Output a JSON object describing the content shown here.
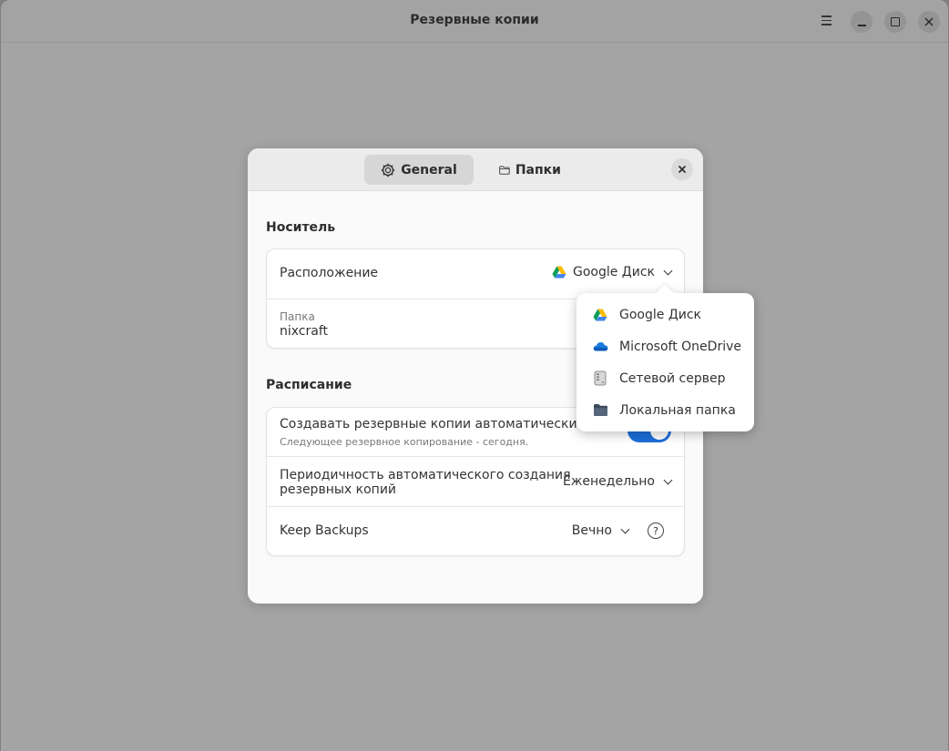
{
  "window": {
    "title": "Резервные копии"
  },
  "dialog": {
    "tabs": [
      {
        "label": "General",
        "icon": "gear-icon",
        "selected": true
      },
      {
        "label": "Папки",
        "icon": "folder-icon",
        "selected": false
      }
    ],
    "storage": {
      "section_title": "Носитель",
      "location_label": "Расположение",
      "location_value": "Google Диск",
      "folder_label": "Папка",
      "folder_value": "nixcraft"
    },
    "schedule": {
      "section_title": "Расписание",
      "auto_backup_label": "Создавать резервные копии автоматически",
      "auto_backup_sub": "Следующее резервное копирование - сегодня.",
      "auto_backup_enabled": true,
      "frequency_label_line1": "Периодичность автоматического создания",
      "frequency_label_line2": "резервных копий",
      "frequency_value": "Еженедельно",
      "keep_label": "Keep Backups",
      "keep_value": "Вечно",
      "help_glyph": "?"
    }
  },
  "dropdown": {
    "items": [
      {
        "label": "Google Диск",
        "icon": "google-drive-icon"
      },
      {
        "label": "Microsoft OneDrive",
        "icon": "onedrive-icon"
      },
      {
        "label": "Сетевой сервер",
        "icon": "network-server-icon"
      },
      {
        "label": "Локальная папка",
        "icon": "local-folder-icon"
      }
    ]
  },
  "colors": {
    "accent": "#1e6fd9",
    "backdrop": "#a4a4a4"
  }
}
